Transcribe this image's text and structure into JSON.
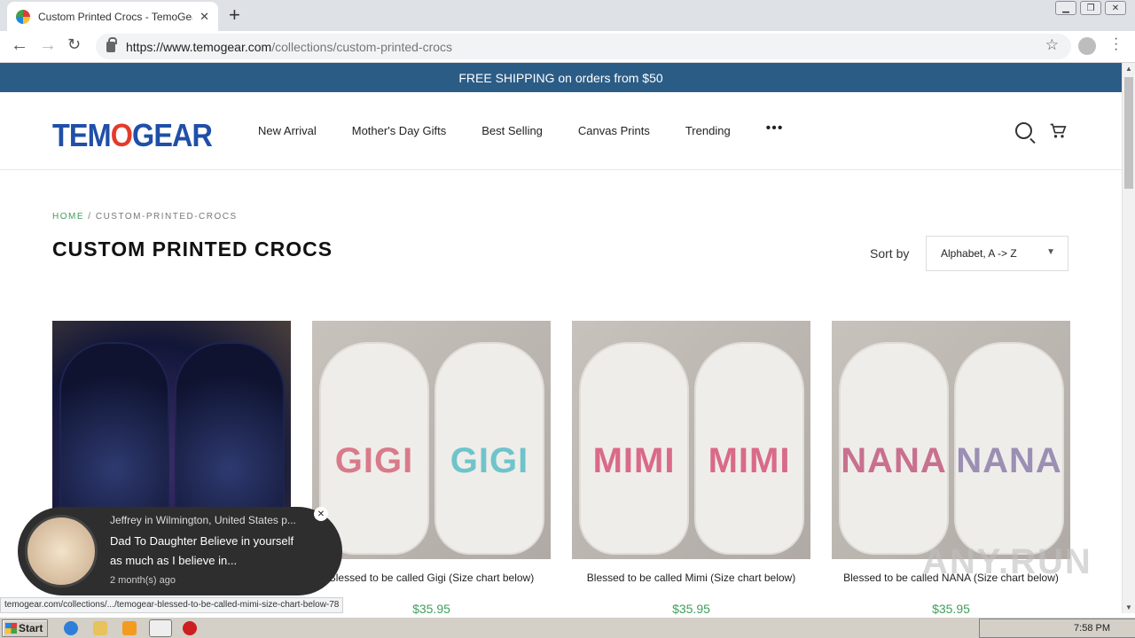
{
  "browser": {
    "tab_title": "Custom Printed Crocs - TemoGearSt",
    "url_host": "https://www.temogear.com",
    "url_path": "/collections/custom-printed-crocs"
  },
  "announcement": "FREE SHIPPING on orders from $50",
  "header": {
    "logo": {
      "part1": "TEM",
      "part2": "O",
      "part3": "GEAR"
    },
    "nav": [
      "New Arrival",
      "Mother's Day Gifts",
      "Best Selling",
      "Canvas Prints",
      "Trending"
    ],
    "more": "•••"
  },
  "breadcrumb": {
    "home": "HOME",
    "sep": " / ",
    "current": "CUSTOM-PRINTED-CROCS"
  },
  "page_title": "CUSTOM PRINTED CROCS",
  "sort": {
    "label": "Sort by",
    "value": "Alphabet, A -> Z"
  },
  "products": [
    {
      "title": "",
      "price": "",
      "shoe_text": ""
    },
    {
      "title": "Blessed to be called Gigi (Size chart below)",
      "price": "$35.95",
      "shoe_text": "GIGI"
    },
    {
      "title": "Blessed to be called Mimi (Size chart below)",
      "price": "$35.95",
      "shoe_text": "MIMI"
    },
    {
      "title": "Blessed to be called NANA (Size chart below)",
      "price": "$35.95",
      "shoe_text": "NANA"
    }
  ],
  "popup": {
    "who": "Jeffrey in Wilmington, United States p...",
    "message": "Dad To Daughter Believe in yourself as much as I believe in...",
    "when": "2 month(s) ago"
  },
  "status_url": "temogear.com/collections/.../temogear-blessed-to-be-called-mimi-size-chart-below-78",
  "watermark": "ANY.RUN",
  "taskbar": {
    "start": "Start",
    "time": "7:58 PM"
  }
}
